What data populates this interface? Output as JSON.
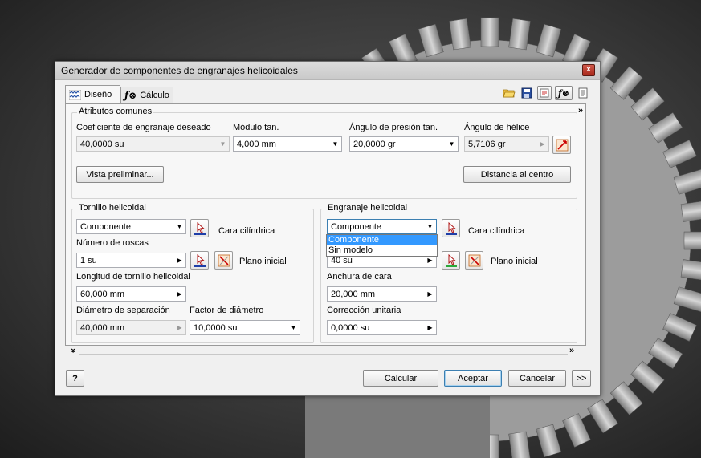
{
  "dialog": {
    "title": "Generador de componentes de engranajes helicoidales",
    "close": "x"
  },
  "tabs": [
    {
      "label": "Diseño"
    },
    {
      "label": "Cálculo"
    }
  ],
  "common": {
    "group": "Atributos comunes",
    "coef_label": "Coeficiente de engranaje deseado",
    "coef_value": "40,0000 su",
    "module_label": "Módulo tan.",
    "module_value": "4,000 mm",
    "pressure_label": "Ángulo de presión tan.",
    "pressure_value": "20,0000 gr",
    "helix_label": "Ángulo de hélice",
    "helix_value": "5,7106 gr",
    "preview_btn": "Vista preliminar...",
    "center_btn": "Distancia al centro"
  },
  "worm": {
    "group": "Tornillo helicoidal",
    "type_value": "Componente",
    "cyl_label": "Cara cilíndrica",
    "threads_label": "Número de roscas",
    "threads_value": "1 su",
    "plane_label": "Plano inicial",
    "length_label": "Longitud de tornillo helicoidal",
    "length_value": "60,000 mm",
    "diameter_label": "Diámetro de separación",
    "diameter_value": "40,000 mm",
    "factor_label": "Factor de diámetro",
    "factor_value": "10,0000 su"
  },
  "gear": {
    "group": "Engranaje helicoidal",
    "type_value": "Componente",
    "cyl_label": "Cara cilíndrica",
    "teeth_value": "40 su",
    "plane_label": "Plano inicial",
    "width_label": "Anchura de cara",
    "width_value": "20,000 mm",
    "correction_label": "Corrección unitaria",
    "correction_value": "0,0000 su",
    "options": [
      "Componente",
      "Sin modelo"
    ]
  },
  "footer": {
    "calc": "Calcular",
    "accept": "Aceptar",
    "cancel": "Cancelar",
    "more": ">>",
    "help": "?"
  },
  "icons": {
    "expand_right": "»",
    "expand_down": "»"
  }
}
